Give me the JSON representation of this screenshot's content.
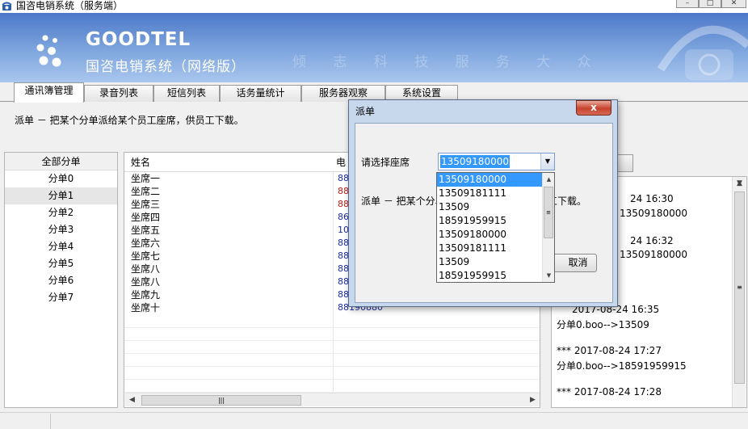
{
  "window": {
    "title": "国咨电销系统（服务端）",
    "minimize": "–",
    "maximize": "□",
    "close": "✕"
  },
  "banner": {
    "brand": "GOODTEL",
    "product": "国咨电销系统（网络版）",
    "slogan": "倾 志 科 技    服 务 大 众"
  },
  "tabs": [
    {
      "label": "通讯簿管理",
      "active": true
    },
    {
      "label": "录音列表",
      "active": false
    },
    {
      "label": "短信列表",
      "active": false
    },
    {
      "label": "话务量统计",
      "active": false
    },
    {
      "label": "服务器观察",
      "active": false
    },
    {
      "label": "系统设置",
      "active": false
    }
  ],
  "description": "派单 － 把某个分单派给某个员工座席，供员工下载。",
  "groups": {
    "header": "全部分单",
    "items": [
      "分单0",
      "分单1",
      "分单2",
      "分单3",
      "分单4",
      "分单5",
      "分单6",
      "分单7"
    ],
    "selected_index": 1
  },
  "table": {
    "columns": [
      "姓名",
      "电"
    ],
    "rows": [
      {
        "name": "坐席一",
        "phone": "88",
        "color": "#1a2ba8"
      },
      {
        "name": "坐席二",
        "phone": "88",
        "color": "#c01818"
      },
      {
        "name": "坐席三",
        "phone": "88",
        "color": "#c01818"
      },
      {
        "name": "坐席四",
        "phone": "86",
        "color": "#1a2ba8"
      },
      {
        "name": "坐席五",
        "phone": "10",
        "color": "#1a2ba8"
      },
      {
        "name": "坐席六",
        "phone": "88",
        "color": "#1a2ba8"
      },
      {
        "name": "坐席七",
        "phone": "88",
        "color": "#1a2ba8"
      },
      {
        "name": "坐席八",
        "phone": "88",
        "color": "#1a2ba8"
      },
      {
        "name": "坐席八",
        "phone": "88",
        "color": "#1a2ba8"
      },
      {
        "name": "坐席九",
        "phone": "88",
        "color": "#1a2ba8"
      },
      {
        "name": "坐席十",
        "phone": "88190880",
        "color": "#1a2ba8"
      }
    ],
    "hscroll_grip": "|||"
  },
  "log": {
    "lines": [
      "24 16:30",
      "13509180000",
      "24 16:32",
      "13509180000",
      "2017-08-24 16:35",
      "分单0.boo-->13509",
      "*** 2017-08-24 17:27",
      "分单0.boo-->18591959915",
      "*** 2017-08-24 17:28"
    ],
    "scroll_grip": "≡"
  },
  "dialog": {
    "title": "派单",
    "close": "x",
    "seat_label": "请选择座席",
    "seat_value": "13509180000",
    "description_head": "派单 － 把某个分单",
    "description_tail": "工下载。",
    "cancel_label": "取消",
    "dropdown_options": [
      "13509180000",
      "13509181111",
      "13509",
      "18591959915",
      "13509180000",
      "13509181111",
      "13509",
      "18591959915"
    ],
    "highlighted_option": 0,
    "scroll_grip": "≡"
  },
  "colors": {
    "banner_top": "#4d79c9",
    "banner_bottom": "#a9c6ee",
    "selection": "#3399ff",
    "phone_blue": "#1a2ba8",
    "phone_red": "#c01818"
  }
}
